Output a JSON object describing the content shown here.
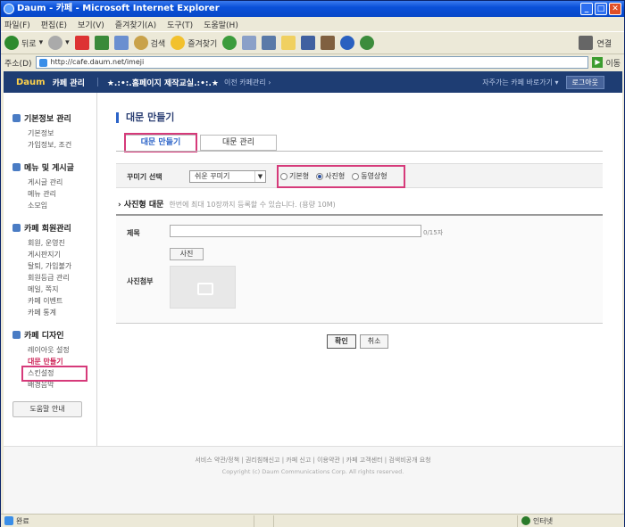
{
  "window": {
    "title": "Daum - 카페 - Microsoft Internet Explorer"
  },
  "menu": [
    "파일(F)",
    "편집(E)",
    "보기(V)",
    "즐겨찾기(A)",
    "도구(T)",
    "도움말(H)"
  ],
  "toolbar": {
    "back": "뒤로",
    "search": "검색",
    "favorites": "즐겨찾기",
    "links": "연결"
  },
  "address": {
    "label": "주소(D)",
    "url": "http://cafe.daum.net/imeji",
    "go": "이동"
  },
  "header": {
    "logo": "Daum",
    "title": "카페 관리",
    "cafe_name": "★.:•:.홈페이지 제작교실.:•:.★",
    "prev": "이전 카페관리 ›",
    "quick": "자주가는 카페 바로가기 ▾",
    "logout": "로그아웃"
  },
  "sidebar": [
    {
      "title": "기본정보 관리",
      "items": [
        "기본정보",
        "가입정보, 조건"
      ]
    },
    {
      "title": "메뉴 및 게시글",
      "items": [
        "게시글 관리",
        "메뉴 관리",
        "소모임"
      ]
    },
    {
      "title": "카페 회원관리",
      "items": [
        "회원, 운영진",
        "게시판지기",
        "탈퇴, 가입불가",
        "회원등급 관리",
        "메일, 쪽지",
        "카페 이벤트",
        "카페 통계"
      ]
    },
    {
      "title": "카페 디자인",
      "items": [
        "레이아웃 설정",
        "대문 만들기",
        "스킨설정",
        "배경음악"
      ]
    }
  ],
  "help_button": "도움말 안내",
  "page": {
    "title": "대문 만들기",
    "tabs": [
      "대문 만들기",
      "대문 관리"
    ],
    "selector_label": "꾸미기 선택",
    "selector_value": "쉬운 꾸미기",
    "radio": [
      "기본형",
      "사진형",
      "동영상형"
    ],
    "radio_selected": "사진형",
    "section": "사진형 대문",
    "section_desc": "한번에 최대 10장까지 등록할 수 있습니다. (용량 10M)",
    "field_title": "제목",
    "count": "0/15자",
    "photo_btn": "사진",
    "field_photo": "사진첨부",
    "confirm": "확인",
    "cancel": "취소"
  },
  "footer": {
    "links": "서비스 약관/정책 | 권리침해신고 | 카페 신고 | 이용약관 | 카페 고객센터 | 검색비공개 요청",
    "copyright": "Copyright (c) Daum Communications Corp. All rights reserved."
  },
  "status": {
    "done": "완료",
    "zone": "인터넷"
  }
}
